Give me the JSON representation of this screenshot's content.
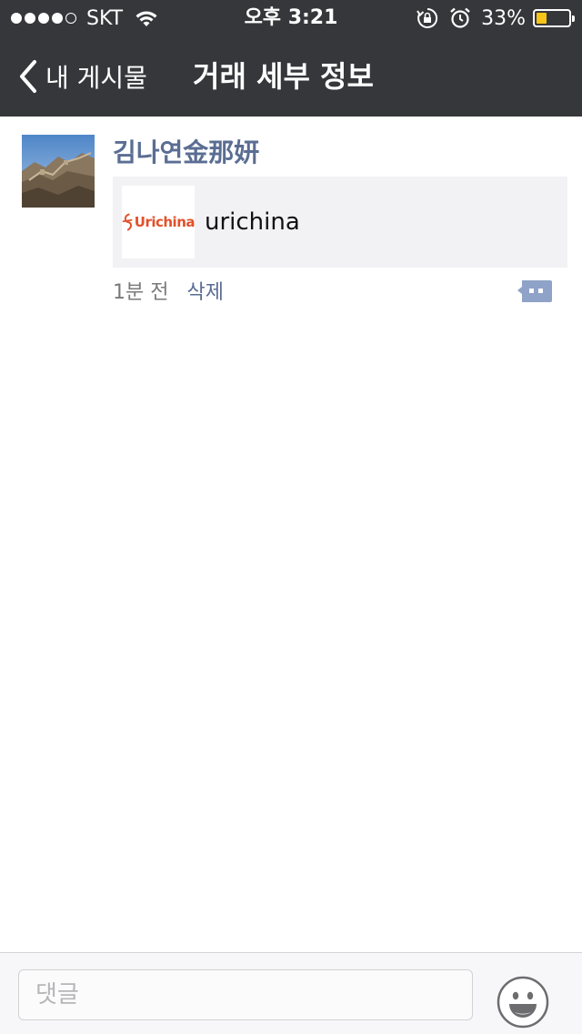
{
  "status_bar": {
    "carrier": "SKT",
    "time": "오후 3:21",
    "battery_percent": "33%",
    "battery_level": 0.33,
    "signal_filled": 4,
    "signal_total": 5,
    "battery_color": "#f5c518"
  },
  "nav": {
    "back_label": "내 게시물",
    "title": "거래 세부 정보"
  },
  "post": {
    "author": "김나연金那妍",
    "link": {
      "logo_text": "Urichina",
      "title": "urichina"
    },
    "time_ago": "1분 전",
    "delete_label": "삭제"
  },
  "composer": {
    "placeholder": "댓글"
  },
  "colors": {
    "topbar_bg": "#36373b",
    "link_blue": "#5a6d93",
    "card_bg": "#f2f2f4",
    "logo_orange": "#e2502a"
  },
  "icons": [
    "wifi-icon",
    "orientation-lock-icon",
    "alarm-icon",
    "battery-icon",
    "back-chevron-icon",
    "comment-icon",
    "emoji-icon"
  ]
}
